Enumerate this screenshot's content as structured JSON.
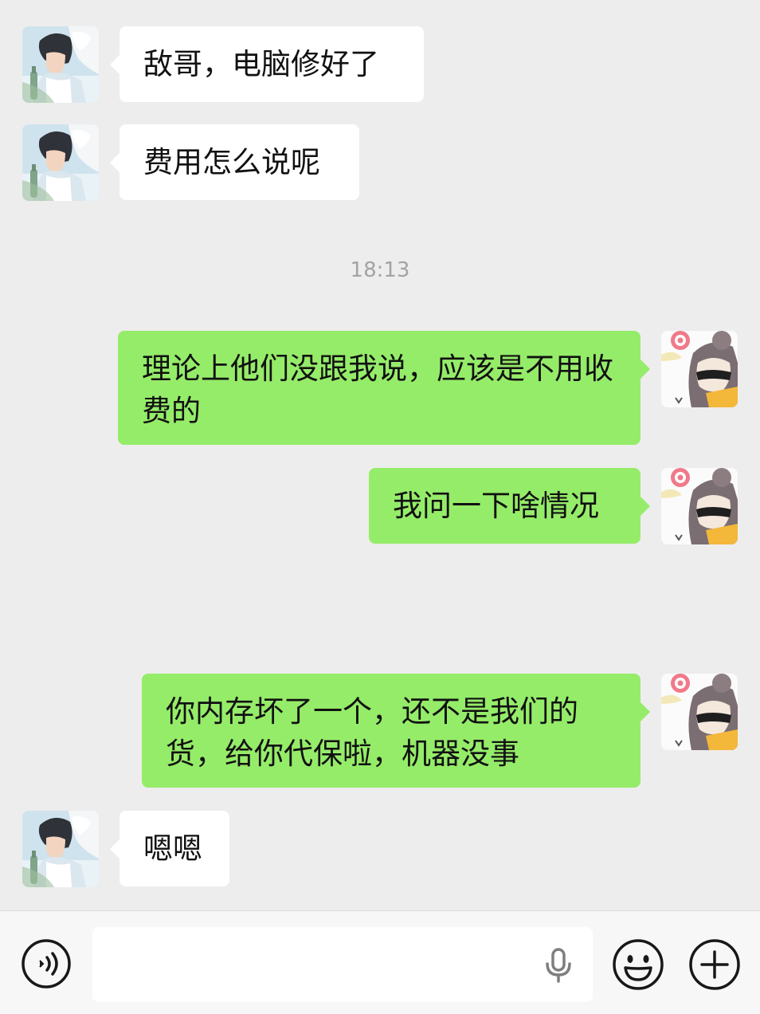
{
  "messages": [
    {
      "text": "敌哥，电脑修好了"
    },
    {
      "text": "费用怎么说呢"
    },
    {
      "text": "理论上他们没跟我说，应该是不用收费的"
    },
    {
      "text": "我问一下啥情况"
    },
    {
      "text": "你内存坏了一个，还不是我们的货，给你代保啦，机器没事"
    },
    {
      "text": "嗯嗯"
    }
  ],
  "timestamps": [
    "18:13"
  ],
  "input": {
    "value": "",
    "placeholder": ""
  },
  "icons": {
    "voice": "voice-mode-icon",
    "mic": "microphone-icon",
    "emoji": "emoji-icon",
    "plus": "plus-icon"
  },
  "colors": {
    "background": "#ededed",
    "outgoing_bubble": "#95ec69",
    "incoming_bubble": "#ffffff",
    "timestamp_text": "#a3a3a3",
    "input_bar": "#f7f7f7"
  }
}
